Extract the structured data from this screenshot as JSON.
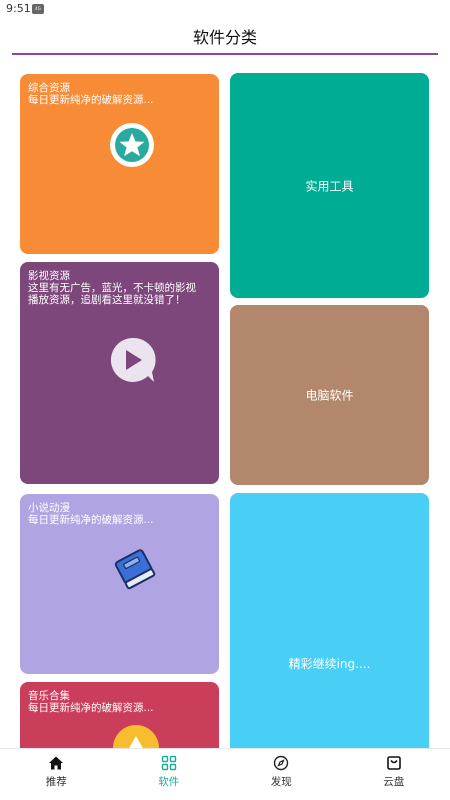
{
  "status_bar": {
    "time": "9:51",
    "badge": "4G"
  },
  "header": {
    "title": "软件分类"
  },
  "cards": {
    "comprehensive": {
      "title": "综合资源",
      "desc": "每日更新纯净的破解资源...",
      "color": "#f78b36",
      "icon": "star-icon"
    },
    "video": {
      "title": "影视资源",
      "desc": "这里有无广告，蓝光，不卡顿的影视\n播放资源，追剧看这里就没错了！",
      "color": "#7d477b",
      "icon": "play-icon"
    },
    "novel": {
      "title": "小说动漫",
      "desc": "每日更新纯净的破解资源...",
      "color": "#b0a5e2",
      "icon": "book-icon"
    },
    "music": {
      "title": "音乐合集",
      "desc": "每日更新纯净的破解资源...",
      "color": "#cb3e5b",
      "icon": "music-icon"
    },
    "tools": {
      "title": "实用工具",
      "color": "#00ad94"
    },
    "pc": {
      "title": "电脑软件",
      "color": "#b2876c"
    },
    "more": {
      "title": "精彩继续ing....",
      "color": "#49cff5"
    }
  },
  "nav": {
    "items": [
      {
        "label": "推荐",
        "icon": "home-icon"
      },
      {
        "label": "软件",
        "icon": "grid-icon",
        "active": true
      },
      {
        "label": "发现",
        "icon": "compass-icon"
      },
      {
        "label": "云盘",
        "icon": "bag-icon"
      }
    ]
  }
}
